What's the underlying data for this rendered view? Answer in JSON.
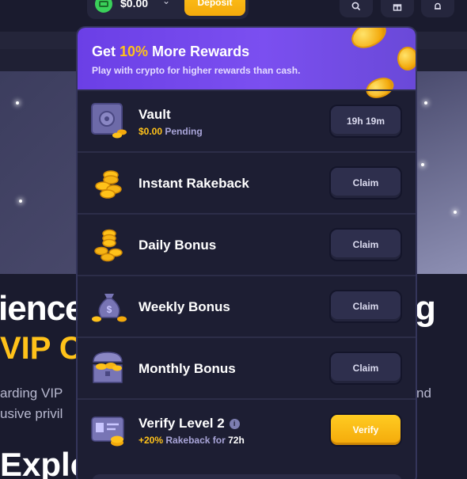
{
  "topbar": {
    "balance": "$0.00",
    "deposit_label": "Deposit",
    "icons": [
      "wallet-coin-icon",
      "chevron-down-icon",
      "search-icon",
      "gift-icon",
      "bell-icon"
    ]
  },
  "background": {
    "heading_left": "ience",
    "heading_right": "g",
    "vip_text": "VIP Cl",
    "text_line1_left": "arding VIP",
    "text_line1_right": "nd",
    "text_line2": "usive privil",
    "explore": "Explo"
  },
  "promo": {
    "title_prefix": "Get ",
    "title_highlight": "10%",
    "title_suffix": " More Rewards",
    "subtitle": "Play with crypto for higher rewards than cash."
  },
  "rewards": [
    {
      "title": "Vault",
      "sub_amount": "$0.00",
      "sub_text": "Pending",
      "button": "19h 19m",
      "icon": "vault-icon"
    },
    {
      "title": "Instant Rakeback",
      "button": "Claim",
      "icon": "coin-stack-icon"
    },
    {
      "title": "Daily Bonus",
      "button": "Claim",
      "icon": "coin-pile-icon"
    },
    {
      "title": "Weekly Bonus",
      "button": "Claim",
      "icon": "money-bag-icon"
    },
    {
      "title": "Monthly Bonus",
      "button": "Claim",
      "icon": "treasure-chest-icon"
    },
    {
      "title": "Verify Level 2",
      "sub_amount": "+20%",
      "sub_text": "Rakeback for",
      "sub_time": "72h",
      "button": "Verify",
      "icon": "id-card-icon"
    }
  ],
  "colors": {
    "accent": "#ffc21a",
    "promo": "#7b4ff0",
    "panel": "#1d1e33"
  }
}
